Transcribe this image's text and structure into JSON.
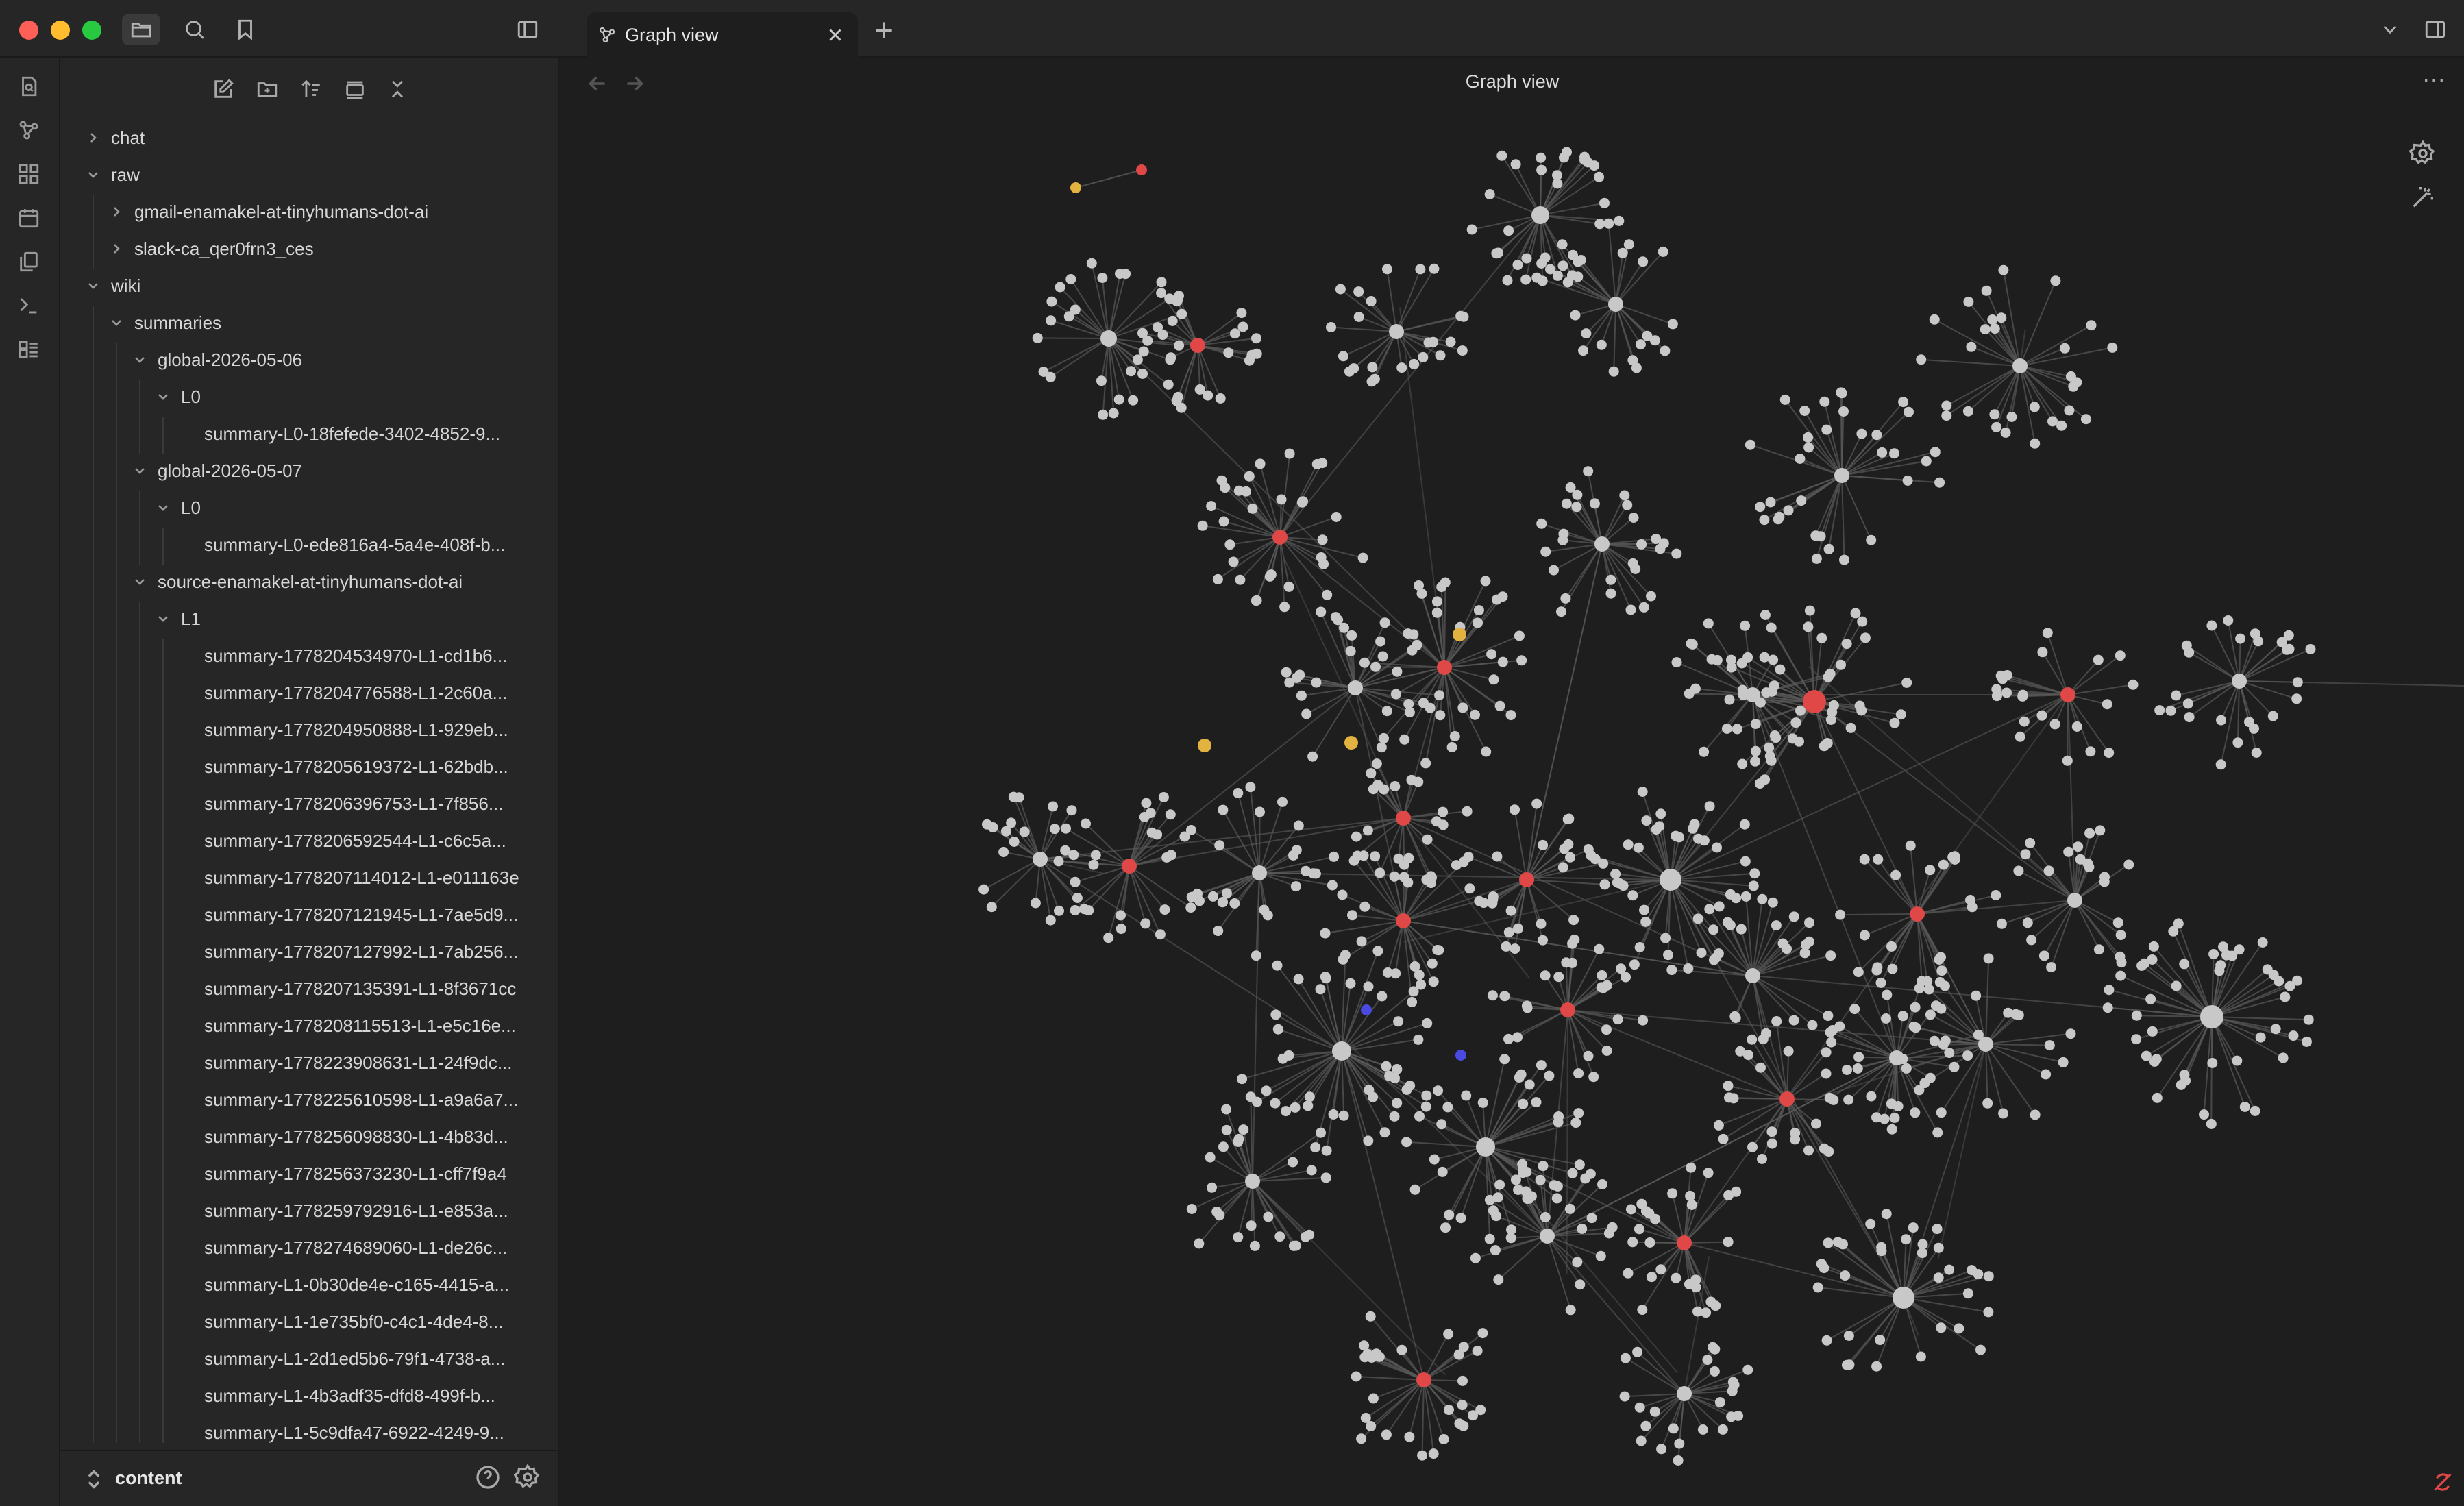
{
  "titlebar": {
    "colors": {
      "close": "#fe5f57",
      "minimize": "#febc2e",
      "maximize": "#28c840"
    }
  },
  "tabs": [
    {
      "label": "Graph view",
      "icon": "graph-icon",
      "active": true
    }
  ],
  "main": {
    "title": "Graph view"
  },
  "sidebar": {
    "tree": [
      {
        "label": "chat",
        "depth": 0,
        "folder": true,
        "expanded": false
      },
      {
        "label": "raw",
        "depth": 0,
        "folder": true,
        "expanded": true
      },
      {
        "label": "gmail-enamakel-at-tinyhumans-dot-ai",
        "depth": 1,
        "folder": true,
        "expanded": false
      },
      {
        "label": "slack-ca_qer0frn3_ces",
        "depth": 1,
        "folder": true,
        "expanded": false
      },
      {
        "label": "wiki",
        "depth": 0,
        "folder": true,
        "expanded": true
      },
      {
        "label": "summaries",
        "depth": 1,
        "folder": true,
        "expanded": true
      },
      {
        "label": "global-2026-05-06",
        "depth": 2,
        "folder": true,
        "expanded": true
      },
      {
        "label": "L0",
        "depth": 3,
        "folder": true,
        "expanded": true
      },
      {
        "label": "summary-L0-18fefede-3402-4852-9...",
        "depth": 4,
        "folder": false
      },
      {
        "label": "global-2026-05-07",
        "depth": 2,
        "folder": true,
        "expanded": true
      },
      {
        "label": "L0",
        "depth": 3,
        "folder": true,
        "expanded": true
      },
      {
        "label": "summary-L0-ede816a4-5a4e-408f-b...",
        "depth": 4,
        "folder": false
      },
      {
        "label": "source-enamakel-at-tinyhumans-dot-ai",
        "depth": 2,
        "folder": true,
        "expanded": true
      },
      {
        "label": "L1",
        "depth": 3,
        "folder": true,
        "expanded": true
      },
      {
        "label": "summary-1778204534970-L1-cd1b6...",
        "depth": 4,
        "folder": false
      },
      {
        "label": "summary-1778204776588-L1-2c60a...",
        "depth": 4,
        "folder": false
      },
      {
        "label": "summary-1778204950888-L1-929eb...",
        "depth": 4,
        "folder": false
      },
      {
        "label": "summary-1778205619372-L1-62bdb...",
        "depth": 4,
        "folder": false
      },
      {
        "label": "summary-1778206396753-L1-7f856...",
        "depth": 4,
        "folder": false
      },
      {
        "label": "summary-1778206592544-L1-c6c5a...",
        "depth": 4,
        "folder": false
      },
      {
        "label": "summary-1778207114012-L1-e011163e",
        "depth": 4,
        "folder": false
      },
      {
        "label": "summary-1778207121945-L1-7ae5d9...",
        "depth": 4,
        "folder": false
      },
      {
        "label": "summary-1778207127992-L1-7ab256...",
        "depth": 4,
        "folder": false
      },
      {
        "label": "summary-1778207135391-L1-8f3671cc",
        "depth": 4,
        "folder": false
      },
      {
        "label": "summary-1778208115513-L1-e5c16e...",
        "depth": 4,
        "folder": false
      },
      {
        "label": "summary-1778223908631-L1-24f9dc...",
        "depth": 4,
        "folder": false
      },
      {
        "label": "summary-1778225610598-L1-a9a6a7...",
        "depth": 4,
        "folder": false
      },
      {
        "label": "summary-1778256098830-L1-4b83d...",
        "depth": 4,
        "folder": false
      },
      {
        "label": "summary-1778256373230-L1-cff7f9a4",
        "depth": 4,
        "folder": false
      },
      {
        "label": "summary-1778259792916-L1-e853a...",
        "depth": 4,
        "folder": false
      },
      {
        "label": "summary-1778274689060-L1-de26c...",
        "depth": 4,
        "folder": false
      },
      {
        "label": "summary-L1-0b30de4e-c165-4415-a...",
        "depth": 4,
        "folder": false
      },
      {
        "label": "summary-L1-1e735bf0-c4c1-4de4-8...",
        "depth": 4,
        "folder": false
      },
      {
        "label": "summary-L1-2d1ed5b6-79f1-4738-a...",
        "depth": 4,
        "folder": false
      },
      {
        "label": "summary-L1-4b3adf35-dfd8-499f-b...",
        "depth": 4,
        "folder": false
      },
      {
        "label": "summary-L1-5c9dfa47-6922-4249-9...",
        "depth": 4,
        "folder": false
      }
    ],
    "vault_name": "content"
  },
  "graph": {
    "colors": {
      "background": "#1e1e1e",
      "link": "#5a5a5a",
      "node_default": "#c8c8c8",
      "node_red": "#e04848",
      "node_yellow": "#e3b341",
      "node_blue": "#4a4ae0"
    }
  },
  "icons": {
    "ribbon": [
      "open-quick-switcher-icon",
      "graph-view-icon",
      "canvas-icon",
      "daily-note-icon",
      "templates-icon",
      "command-palette-icon",
      "bases-icon"
    ],
    "sidebar_toolbar": [
      "new-note-icon",
      "new-folder-icon",
      "sort-icon",
      "collapse-all-icon",
      "close-icon"
    ]
  }
}
